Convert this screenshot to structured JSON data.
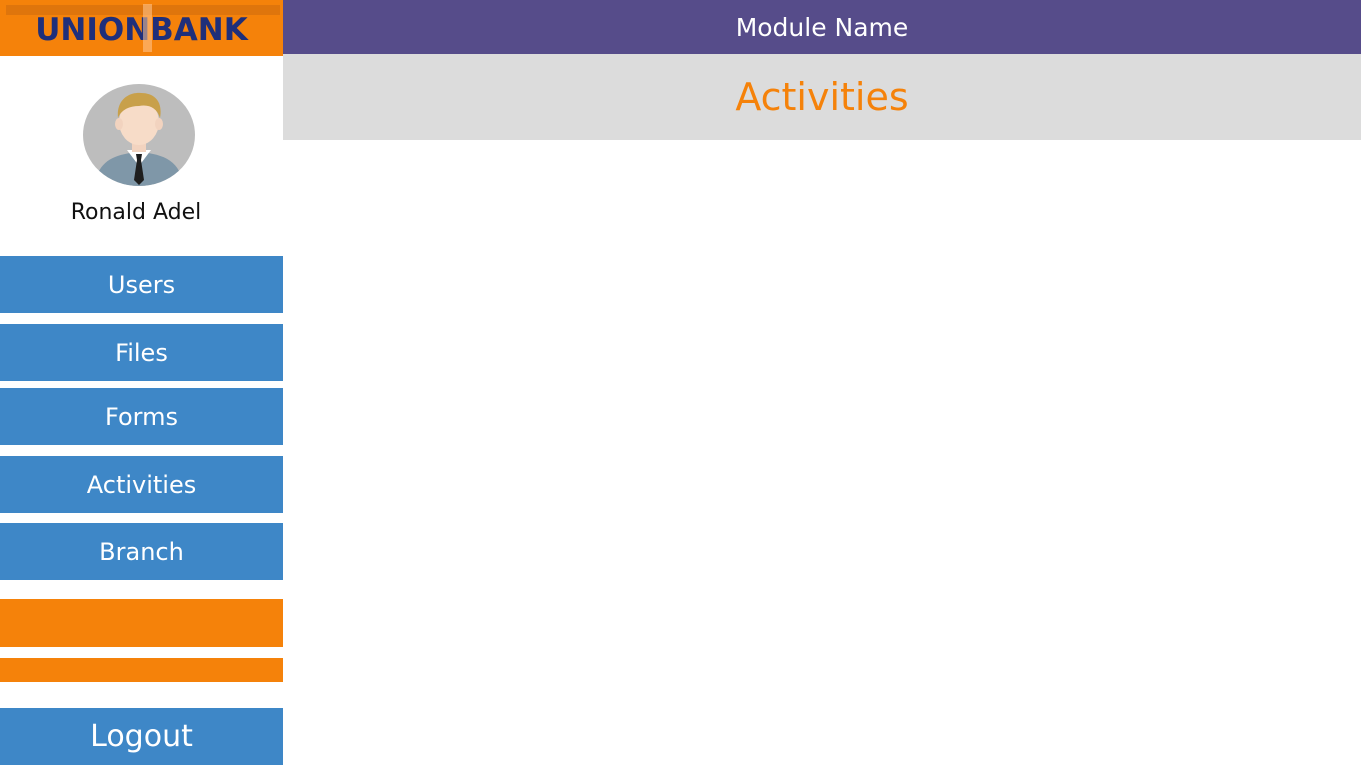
{
  "brand": {
    "logo_text": "UNIONBANK",
    "primary_color": "#f5820a",
    "nav_color": "#3e87c7",
    "header_color": "#564c8a",
    "title_color": "#f5820a"
  },
  "user": {
    "name": "Ronald Adel",
    "avatar_icon": "user-avatar-icon"
  },
  "sidebar": {
    "items": [
      {
        "label": "Users"
      },
      {
        "label": "Files"
      },
      {
        "label": "Forms"
      },
      {
        "label": "Activities"
      },
      {
        "label": "Branch"
      }
    ],
    "logout_label": "Logout"
  },
  "header": {
    "module_name": "Module Name",
    "page_title": "Activities"
  }
}
